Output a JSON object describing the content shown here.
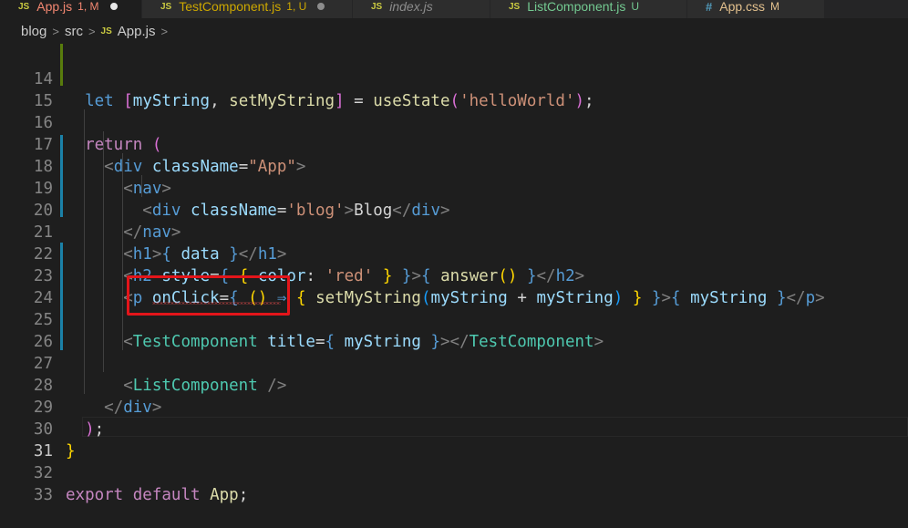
{
  "tabs": [
    {
      "name": "App.js",
      "badge": "1, M",
      "badge_color": "#f48771",
      "icon": "js-icon",
      "active": true,
      "dirty": true
    },
    {
      "name": "TestComponent.js",
      "badge": "1, U",
      "icon": "js-icon",
      "active": false
    },
    {
      "name": "index.js",
      "badge": "",
      "icon": "js-icon",
      "active": false
    },
    {
      "name": "ListComponent.js",
      "badge": "U",
      "icon": "js-icon",
      "active": false
    },
    {
      "name": "App.css",
      "badge": "M",
      "icon": "css-hash-icon",
      "active": false
    }
  ],
  "breadcrumb": {
    "items": [
      "blog",
      "src",
      "App.js"
    ],
    "file_icon": "JS"
  },
  "editor": {
    "line_numbers": [
      "14",
      "15",
      "16",
      "17",
      "18",
      "19",
      "20",
      "21",
      "22",
      "23",
      "24",
      "25",
      "26",
      "27",
      "28",
      "29",
      "30",
      "31",
      "32",
      "33"
    ],
    "current_line": "31",
    "code": {
      "l14_let": "let",
      "l14_mystring": "myString",
      "l14_setmystring": "setMyString",
      "l14_usestate": "useState",
      "l14_arg": "'helloWorld'",
      "l16_return": "return",
      "l17_div": "div",
      "l17_attr": "className",
      "l17_val": "\"App\"",
      "l18_nav": "nav",
      "l19_div": "div",
      "l19_attr": "className",
      "l19_val": "'blog'",
      "l19_text": "Blog",
      "l21_h1": "h1",
      "l21_data": "data",
      "l22_h2": "h2",
      "l22_style": "style",
      "l22_color": "color",
      "l22_red": "'red'",
      "l22_answer": "answer",
      "l23_p": "p",
      "l23_onclick": "onClick",
      "l23_arrow": "⇒",
      "l23_set": "setMyString",
      "l23_ms1": "myString",
      "l23_ms2": "myString",
      "l23_ms3": "myString",
      "l25_tc": "TestComponent",
      "l25_title": "title",
      "l25_ms": "myString",
      "l27_lc": "ListComponent",
      "l28_div": "div",
      "l32_export": "export",
      "l32_default": "default",
      "l32_app": "App"
    }
  },
  "annotation": {
    "highlight_color": "#e3151a",
    "target": "TestComponent"
  }
}
